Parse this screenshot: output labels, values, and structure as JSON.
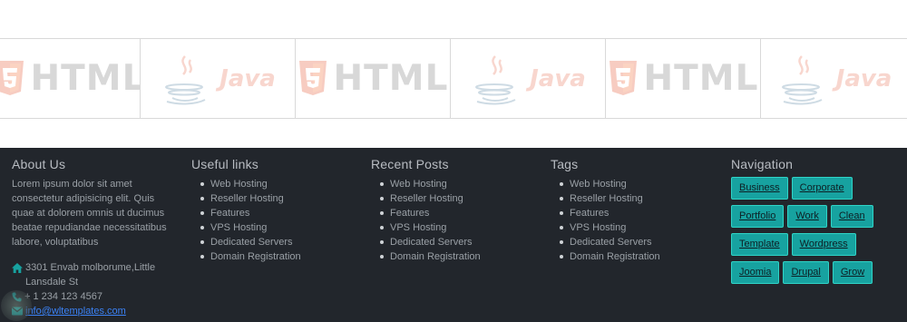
{
  "logos": [
    {
      "kind": "html",
      "label": "HTML"
    },
    {
      "kind": "java",
      "label": "Java"
    },
    {
      "kind": "html",
      "label": "HTML"
    },
    {
      "kind": "java",
      "label": "Java"
    },
    {
      "kind": "html",
      "label": "HTML"
    },
    {
      "kind": "java",
      "label": "Java"
    }
  ],
  "footer": {
    "about": {
      "title": "About Us",
      "text": "Lorem ipsum dolor sit amet consectetur adipisicing elit. Quis quae at dolorem omnis ut ducimus beatae repudiandae necessitatibus labore, voluptatibus",
      "address": "3301 Envab molborume,Little Lansdale St",
      "phone": "+ 1 234 123 4567",
      "email": "info@wltemplates.com"
    },
    "useful_links": {
      "title": "Useful links",
      "items": [
        "Web Hosting",
        "Reseller Hosting",
        "Features",
        "VPS Hosting",
        "Dedicated Servers",
        "Domain Registration"
      ]
    },
    "recent_posts": {
      "title": "Recent Posts",
      "items": [
        "Web Hosting",
        "Reseller Hosting",
        "Features",
        "VPS Hosting",
        "Dedicated Servers",
        "Domain Registration"
      ]
    },
    "tags": {
      "title": "Tags",
      "items": [
        "Web Hosting",
        "Reseller Hosting",
        "Features",
        "VPS Hosting",
        "Dedicated Servers",
        "Domain Registration"
      ]
    },
    "navigation": {
      "title": "Navigation",
      "buttons": [
        "Business",
        "Corporate",
        "Portfolio",
        "Work",
        "Clean",
        "Template",
        "Wordpress",
        "Joomia",
        "Drupal",
        "Grow"
      ]
    }
  },
  "colors": {
    "footer_bg": "#22262c",
    "tag_bg": "#17a2a0",
    "link": "#3b82f6"
  }
}
